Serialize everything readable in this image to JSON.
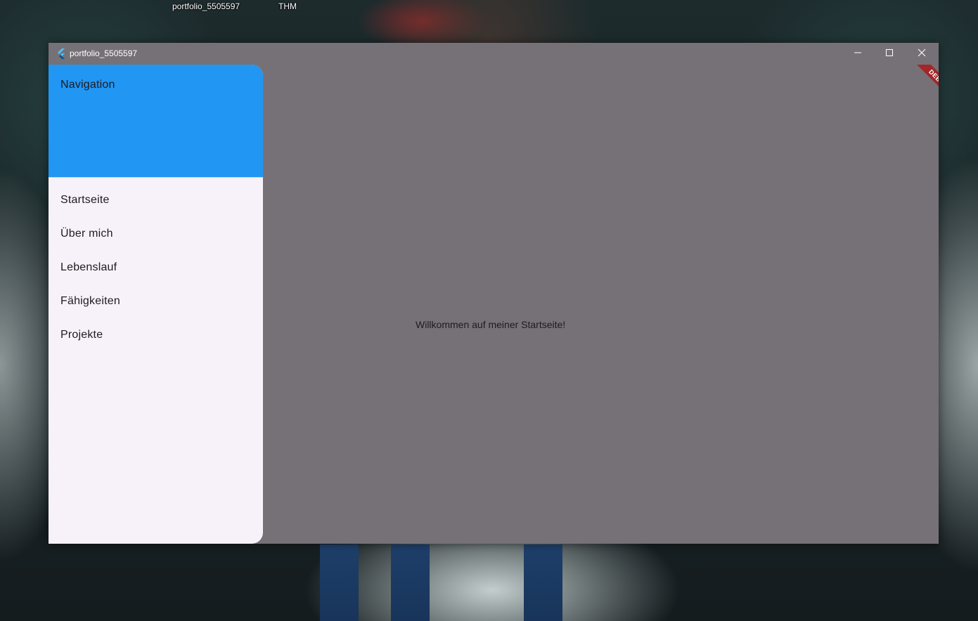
{
  "desktop": {
    "labels": [
      "portfolio_5505597",
      "THM"
    ]
  },
  "window": {
    "title": "portfolio_5505597",
    "icon": "flutter-logo-icon",
    "controls": {
      "minimize": "minimize-icon",
      "maximize": "maximize-icon",
      "close": "close-icon"
    }
  },
  "drawer": {
    "header_title": "Navigation",
    "items": [
      {
        "label": "Startseite"
      },
      {
        "label": "Über mich"
      },
      {
        "label": "Lebenslauf"
      },
      {
        "label": "Fähigkeiten"
      },
      {
        "label": "Projekte"
      }
    ]
  },
  "main": {
    "welcome_text": "Willkommen auf meiner Startseite!"
  },
  "debug_banner": {
    "label": "DEBUG"
  },
  "colors": {
    "drawer_header": "#2196f3",
    "drawer_bg": "#f7f2f9",
    "content_bg": "#767176",
    "debug_ribbon": "#a4262a"
  }
}
